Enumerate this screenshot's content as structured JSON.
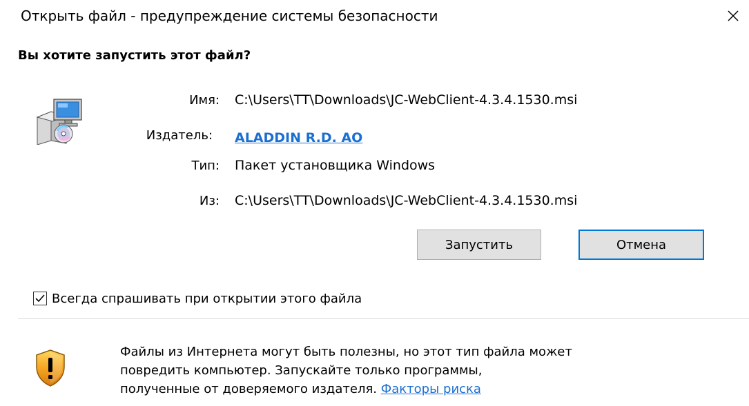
{
  "window": {
    "title": "Открыть файл - предупреждение системы безопасности",
    "close_icon": "close-icon"
  },
  "dialog": {
    "question": "Вы хотите запустить этот файл?",
    "icon": "installer-package-icon",
    "fields": {
      "name_label": "Имя:",
      "name_value": "C:\\Users\\TT\\Downloads\\JC-WebClient-4.3.4.1530.msi",
      "publisher_label": "Издатель:",
      "publisher_value": "ALADDIN R.D. AO",
      "type_label": "Тип:",
      "type_value": "Пакет установщика Windows",
      "from_label": "Из:",
      "from_value": "C:\\Users\\TT\\Downloads\\JC-WebClient-4.3.4.1530.msi"
    },
    "buttons": {
      "run_label": "Запустить",
      "cancel_label": "Отмена"
    },
    "checkbox": {
      "label": "Всегда спрашивать при открытии этого файла",
      "checked": true
    }
  },
  "footer": {
    "icon": "shield-warning-icon",
    "warning_line1": "Файлы из Интернета могут быть полезны, но этот тип файла может",
    "warning_line2": "повредить компьютер. Запускайте только программы,",
    "warning_line3_prefix": "полученные от доверяемого издателя.",
    "risk_link": "Факторы риска"
  },
  "colors": {
    "link": "#1a6fd1",
    "button_bg": "#e1e1e1",
    "button_border": "#adadad",
    "focus_border": "#0078d7",
    "shield_orange": "#f5a623",
    "divider": "#d9d9d9"
  }
}
